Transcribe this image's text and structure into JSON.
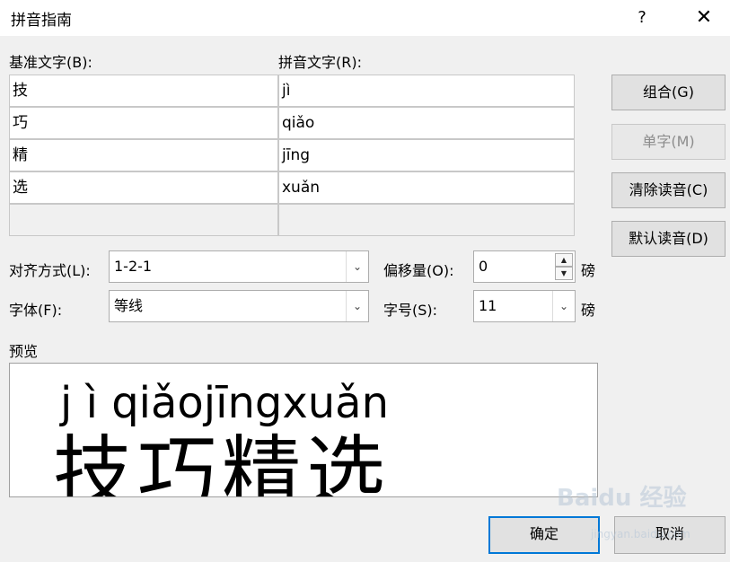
{
  "dialog": {
    "title": "拼音指南",
    "help": "?",
    "close": "✕"
  },
  "table": {
    "base_header": "基准文字(B):",
    "ruby_header": "拼音文字(R):",
    "rows": [
      {
        "base": "技",
        "ruby": "jì"
      },
      {
        "base": "巧",
        "ruby": "qiǎo"
      },
      {
        "base": "精",
        "ruby": "jīng"
      },
      {
        "base": "选",
        "ruby": "xuǎn"
      },
      {
        "base": "",
        "ruby": ""
      }
    ]
  },
  "buttons": {
    "group": "组合(G)",
    "mono": "单字(M)",
    "clear": "清除读音(C)",
    "default": "默认读音(D)",
    "ok": "确定",
    "cancel": "取消"
  },
  "options": {
    "alignment_label": "对齐方式(L):",
    "alignment_value": "1-2-1",
    "offset_label": "偏移量(O):",
    "offset_value": "0",
    "offset_unit": "磅",
    "font_label": "字体(F):",
    "font_value": "等线",
    "size_label": "字号(S):",
    "size_value": "11",
    "size_unit": "磅"
  },
  "preview": {
    "label": "预览",
    "pinyin": "j  ì qiǎojīngxuǎn",
    "hanzi": "技巧精选"
  },
  "watermark": {
    "text": "Baidu 经验",
    "sub": "jingyan.baidu.com"
  }
}
